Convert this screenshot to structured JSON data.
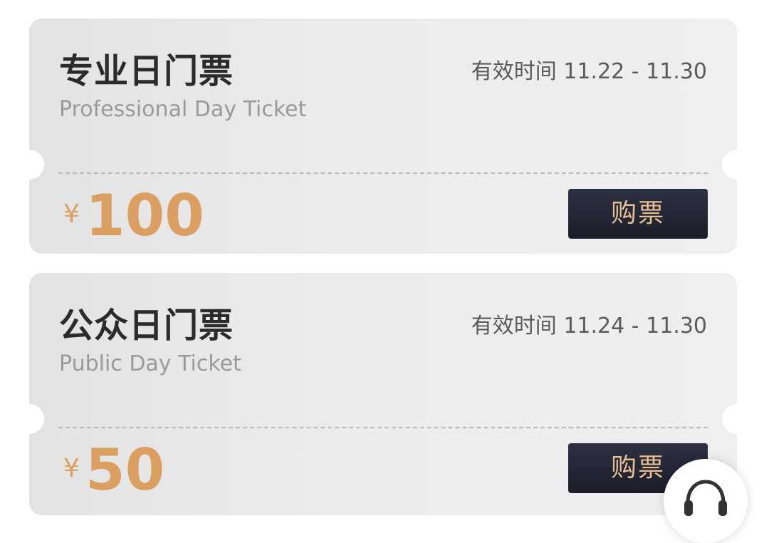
{
  "tickets": [
    {
      "title": "专业日门票",
      "subtitle": "Professional Day Ticket",
      "validity": "有效时间 11.22 - 11.30",
      "currency": "¥",
      "price": "100",
      "buy_label": "购票"
    },
    {
      "title": "公众日门票",
      "subtitle": "Public Day Ticket",
      "validity": "有效时间 11.24 - 11.30",
      "currency": "¥",
      "price": "50",
      "buy_label": "购票"
    }
  ],
  "colors": {
    "price": "#dba061",
    "button_bg": "#1b1d29",
    "button_text": "#e6bf93",
    "title": "#2b2b2b",
    "subtitle": "#9a9a9a"
  },
  "support": {
    "icon": "headset-icon"
  }
}
